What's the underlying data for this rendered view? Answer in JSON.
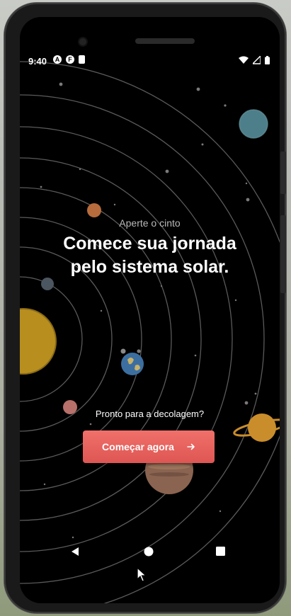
{
  "status_bar": {
    "time": "9:40",
    "left_icons": [
      "A",
      "F",
      "sd-card-icon"
    ],
    "right_icons": [
      "wifi-icon",
      "signal-icon",
      "battery-icon"
    ]
  },
  "hero": {
    "subtitle": "Aperte o cinto",
    "title_line1": "Comece sua jornada",
    "title_line2": "pelo sistema solar."
  },
  "prompt": "Pronto para a decolagem?",
  "cta": {
    "label": "Começar agora",
    "icon": "arrow-right-icon",
    "color": "#e2605c"
  },
  "nav_bar": {
    "back": "back-icon",
    "home": "home-icon",
    "recents": "recents-icon"
  },
  "colors": {
    "background": "#000000",
    "accent": "#e2605c"
  }
}
